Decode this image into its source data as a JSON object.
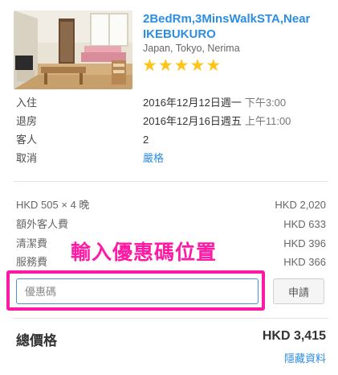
{
  "listing": {
    "title": "2BedRm,3MinsWalkSTA,Near IKEBUKURO",
    "location": "Japan, Tokyo, Nerima",
    "rating_stars": 5,
    "star_color": "#ffc41a",
    "title_color": "#2d8de0",
    "image_icon": "room-photo"
  },
  "details": {
    "checkin_label": "入住",
    "checkin_date": "2016年12月12日週一",
    "checkin_time": "下午3:00",
    "checkout_label": "退房",
    "checkout_date": "2016年12月16日週五",
    "checkout_time": "上午11:00",
    "guests_label": "客人",
    "guests_value": "2",
    "cancel_label": "取消",
    "cancel_value": "嚴格"
  },
  "pricing": {
    "nights_label": "HKD 505 × 4 晚",
    "nights_amount": "HKD 2,020",
    "extra_guest_label": "額外客人費",
    "extra_guest_amount": "HKD 633",
    "cleaning_label": "清潔費",
    "cleaning_amount": "HKD 396",
    "service_label": "服務費",
    "service_amount": "HKD 366"
  },
  "promo": {
    "annotation": "輸入優惠碼位置",
    "annotation_color": "#ff1aa6",
    "placeholder": "優惠碼",
    "apply_label": "申請"
  },
  "total": {
    "label": "總價格",
    "amount": "HKD 3,415",
    "hide_details": "隱藏資料"
  }
}
